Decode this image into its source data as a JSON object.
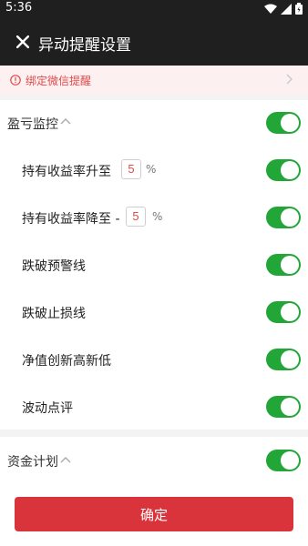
{
  "status_bar": {
    "time": "5:36"
  },
  "header": {
    "title": "异动提醒设置",
    "close_icon": "close-icon"
  },
  "banner": {
    "label": "绑定微信提醒",
    "icon": "info-icon"
  },
  "profit_monitor": {
    "label": "盈亏监控",
    "enabled": true,
    "items": [
      {
        "label": "持有收益率升至",
        "value": "5",
        "unit": "%",
        "enabled": true
      },
      {
        "label": "持有收益率降至 -",
        "value": "5",
        "unit": "%",
        "enabled": true
      },
      {
        "label": "跌破预警线",
        "enabled": true
      },
      {
        "label": "跌破止损线",
        "enabled": true
      },
      {
        "label": "净值创新高新低",
        "enabled": true
      },
      {
        "label": "波动点评",
        "enabled": true
      }
    ]
  },
  "fund_plan": {
    "label": "资金计划",
    "enabled": true
  },
  "footer": {
    "confirm_label": "确定"
  },
  "colors": {
    "accent": "#d9343c",
    "toggle_on": "#22a638",
    "warning_text": "#e04a4a"
  }
}
